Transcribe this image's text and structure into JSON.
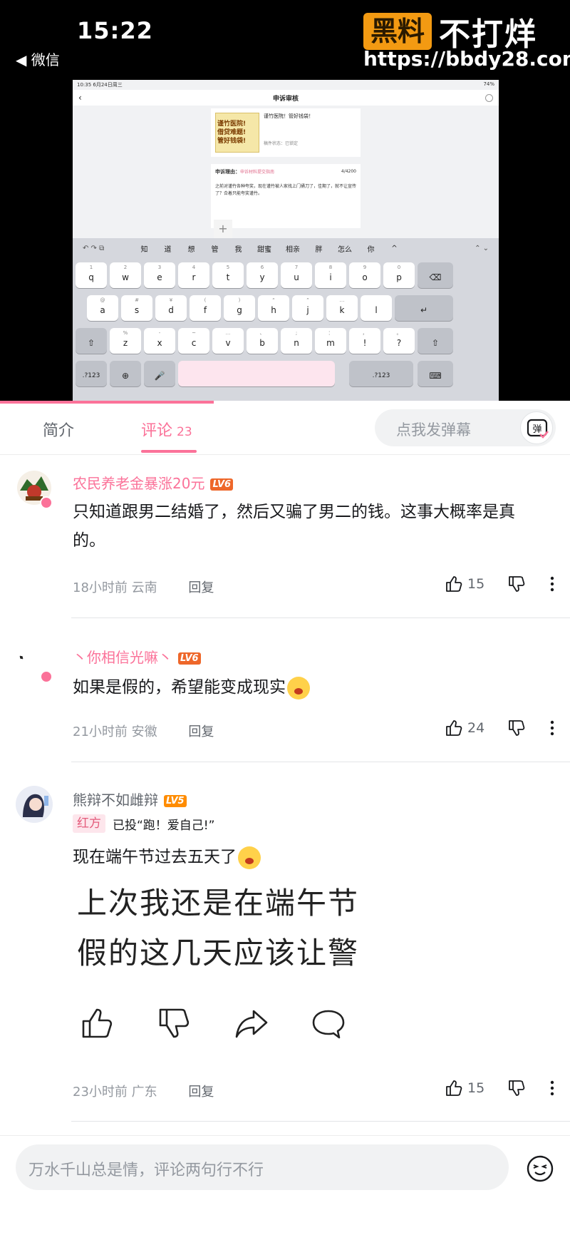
{
  "status_bar": {
    "time": "15:22",
    "back_label": "◀ 微信"
  },
  "watermark": {
    "box_text": "黑料",
    "text": "不打烊",
    "url": "https://bbdy28.com"
  },
  "tablet": {
    "status_time": "10:35  6月24日周三",
    "status_right": "74%",
    "nav_title": "申诉审核",
    "card_title": "谨竹医院！管好钱袋！",
    "card_status": "稿件状态：已锁定",
    "thumb_lines": [
      "谨竹医院!",
      "借贷难题!",
      "管好钱袋!"
    ],
    "appeal_label": "申诉理由：",
    "appeal_link": "申诉材料提交指南",
    "appeal_count": "4/4200",
    "appeal_text": "之前对谨竹各种夸奖，现在谨竹被人家找上门捅刀了，佳期了，就不让宣传了？合着只能夸奖谨竹。",
    "plus": "+",
    "keyboard_tools": "↶ ↷ ⧉",
    "candidates": [
      "知",
      "道",
      "想",
      "管",
      "我",
      "甜蜜",
      "相亲",
      "胖",
      "怎么",
      "你"
    ],
    "cand_arrow": "^",
    "right_arrows": "⌃ ⌄",
    "row1": [
      "q",
      "w",
      "e",
      "r",
      "t",
      "y",
      "u",
      "i",
      "o",
      "p"
    ],
    "row1_sup": [
      "1",
      "2",
      "3",
      "4",
      "5",
      "6",
      "7",
      "8",
      "9",
      "0"
    ],
    "row2": [
      "a",
      "s",
      "d",
      "f",
      "g",
      "h",
      "j",
      "k",
      "l"
    ],
    "row2_sup": [
      "@",
      "#",
      "¥",
      "(",
      ")",
      "“",
      "”",
      "…",
      ""
    ],
    "row3": [
      "z",
      "x",
      "c",
      "v",
      "b",
      "n",
      "m",
      "!",
      "?"
    ],
    "row3_sup": [
      "%",
      "-",
      "~",
      "...",
      "、",
      ";",
      "：",
      "，",
      "。"
    ],
    "key_num": ".?123",
    "key_globe": "⊕",
    "key_mic": "🎤",
    "key_delete": "⌫",
    "key_return": "↵",
    "key_shift": "⇧",
    "key_keyboard": "⌨"
  },
  "tabs": {
    "intro": "简介",
    "comments": "评论",
    "comments_count": "23",
    "danmaku_placeholder": "点我发弹幕",
    "danmaku_icon_text": "弹"
  },
  "comments": [
    {
      "username": "农民养老金暴涨20元",
      "level": "LV6",
      "text": "只知道跟男二结婚了，然后又骗了男二的钱。这事大概率是真的。",
      "time": "18小时前",
      "location": "云南",
      "reply": "回复",
      "likes": "15"
    },
    {
      "username": "丶你相信光嘛丶",
      "level": "LV6",
      "text": "如果是假的，希望能变成现实",
      "time": "21小时前",
      "location": "安徽",
      "reply": "回复",
      "likes": "24"
    },
    {
      "username": "熊辩不如雌辩",
      "level": "LV5",
      "vote_tag": "红方",
      "vote_text": "已投“跑！爱自己!”",
      "text": "现在端午节过去五天了",
      "image_lines": [
        "上次我还是在端午节",
        "假的这几天应该让警"
      ],
      "time": "23小时前",
      "location": "广东",
      "reply": "回复",
      "likes": "15"
    }
  ],
  "bottom": {
    "placeholder": "万水千山总是情，评论两句行不行"
  },
  "colors": {
    "accent": "#fb7299",
    "level6": "#ee672a",
    "level5": "#ff8c00",
    "watermark": "#f39a12"
  }
}
